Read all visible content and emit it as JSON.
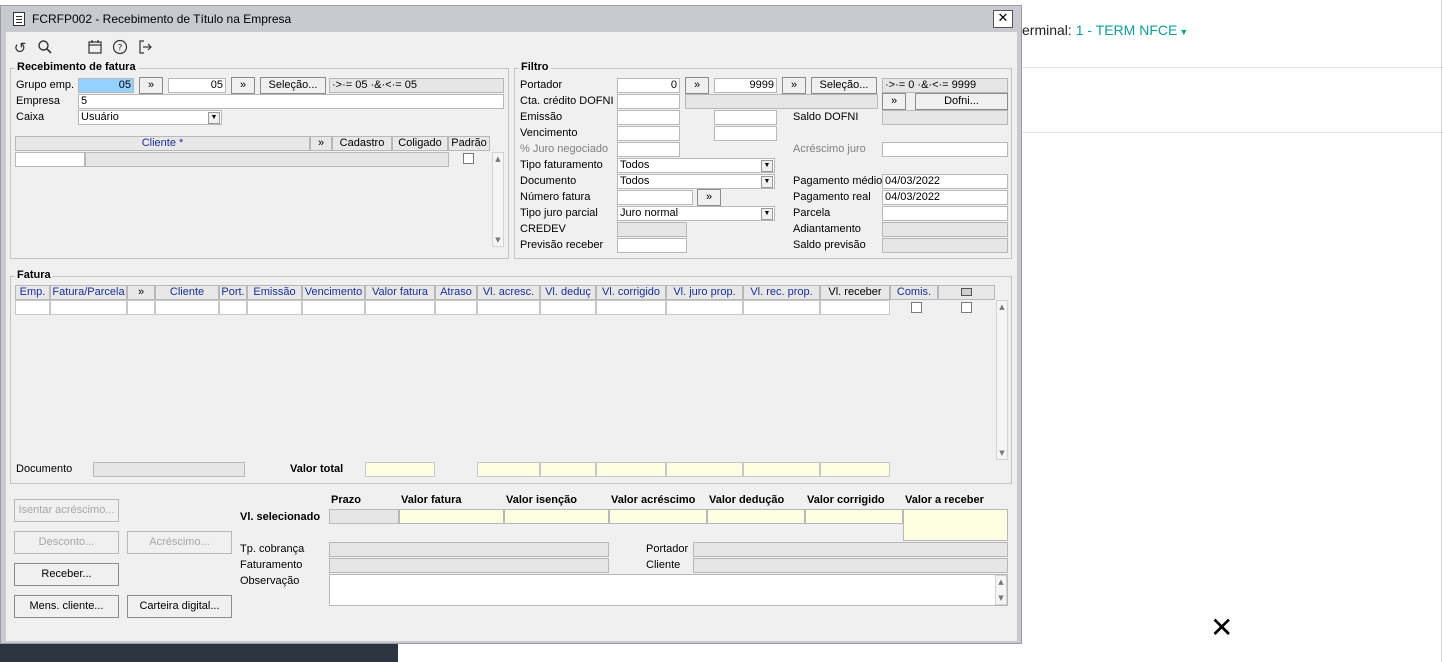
{
  "background": {
    "terminal_prefix": "erminal:",
    "terminal_value": "1 - TERM NFCE",
    "close_icon": "✕"
  },
  "window": {
    "title": "FCRFP002 - Recebimento de Título na Empresa",
    "close": "✕"
  },
  "toolbar": {
    "icons": [
      "undo-icon",
      "search-icon",
      "calendar-icon",
      "help-icon",
      "exit-icon"
    ]
  },
  "recebimento": {
    "title": "Recebimento de fatura",
    "grupo_label": "Grupo emp.",
    "grupo_from": "05",
    "grupo_to": "05",
    "range_btn": "»",
    "selecao_btn": "Seleção...",
    "grupo_expr": "·>·= 05 ·&·<·= 05",
    "empresa_label": "Empresa",
    "empresa_value": "5",
    "caixa_label": "Caixa",
    "caixa_value": "Usuário",
    "cliente_header": "Cliente *",
    "cliente_range": "»",
    "cadastro_header": "Cadastro",
    "coligado_header": "Coligado",
    "padrao_header": "Padrão"
  },
  "filtro": {
    "title": "Filtro",
    "portador_label": "Portador",
    "portador_from": "0",
    "portador_to": "9999",
    "selecao_btn": "Seleção...",
    "portador_expr": "·>·= 0 ·&·<·= 9999",
    "cta_label": "Cta. crédito DOFNI",
    "dofni_btn": "Dofni...",
    "emissao_label": "Emissão",
    "saldo_dofni_label": "Saldo DOFNI",
    "vencimento_label": "Vencimento",
    "juro_neg_label": "% Juro negociado",
    "acrescimo_juro_label": "Acréscimo juro",
    "tipo_fat_label": "Tipo faturamento",
    "tipo_fat_value": "Todos",
    "pag_medio_label": "Pagamento médio",
    "pag_medio_value": "04/03/2022",
    "documento_label": "Documento",
    "documento_value": "Todos",
    "pag_real_label": "Pagamento real",
    "pag_real_value": "04/03/2022",
    "numero_fatura_label": "Número fatura",
    "parcela_label": "Parcela",
    "tipo_juro_label": "Tipo juro parcial",
    "tipo_juro_value": "Juro normal",
    "adiantamento_label": "Adiantamento",
    "credev_label": "CREDEV",
    "saldo_prev_label": "Saldo previsão",
    "prev_receber_label": "Previsão receber"
  },
  "fatura": {
    "title": "Fatura",
    "columns": [
      "Emp.",
      "Fatura/Parcela",
      "»",
      "Cliente",
      "Port.",
      "Emissão",
      "Vencimento",
      "Valor fatura",
      "Atraso",
      "Vl. acresc.",
      "Vl. deduç",
      "Vl. corrigido",
      "Vl. juro prop.",
      "Vl. rec. prop.",
      "Vl. receber",
      "Comis."
    ],
    "documento_label": "Documento",
    "valor_total_label": "Valor total"
  },
  "bottom": {
    "isentar_btn": "Isentar acréscimo...",
    "desconto_btn": "Desconto...",
    "acrescimo_btn": "Acréscimo...",
    "receber_btn": "Receber...",
    "mens_btn": "Mens. cliente...",
    "carteira_btn": "Carteira digital...",
    "prazo_header": "Prazo",
    "valor_fatura_header": "Valor fatura",
    "valor_isencao_header": "Valor isenção",
    "valor_acrescimo_header": "Valor acréscimo",
    "valor_deducao_header": "Valor dedução",
    "valor_corrigido_header": "Valor corrigido",
    "valor_receber_header": "Valor a receber",
    "vl_selecionado_label": "Vl. selecionado",
    "tp_cobranca_label": "Tp. cobrança",
    "portador_label": "Portador",
    "faturamento_label": "Faturamento",
    "cliente_label": "Cliente",
    "observacao_label": "Observação"
  }
}
